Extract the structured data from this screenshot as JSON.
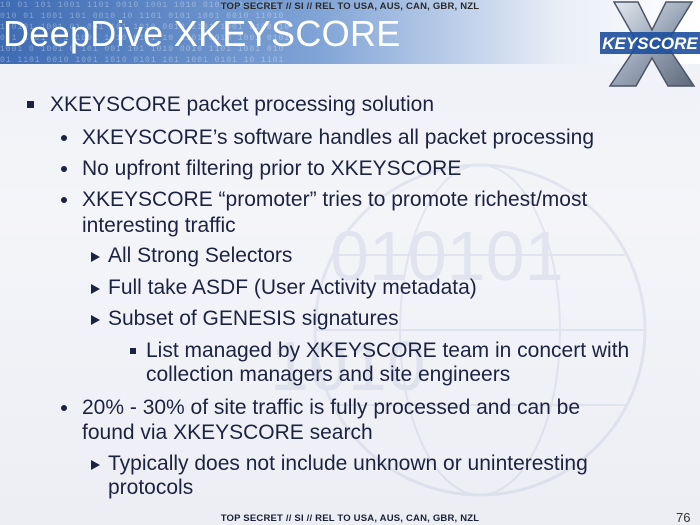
{
  "classification": {
    "top": "TOP SECRET // SI // REL TO USA, AUS, CAN, GBR, NZL",
    "bottom": "TOP SECRET // SI // REL TO USA, AUS, CAN, GBR, NZL"
  },
  "title": "DeepDive XKEYSCORE",
  "logo": {
    "text": "KEYSCORE",
    "icon": "xkeyscore-x-logo"
  },
  "bullets": {
    "l1": "XKEYSCORE packet processing solution",
    "l2a": "XKEYSCORE’s software handles all packet processing",
    "l2b": "No upfront filtering prior to XKEYSCORE",
    "l2c_1": "XKEYSCORE “promoter” tries to promote richest/most",
    "l2c_2": "interesting traffic",
    "l3a": "All Strong Selectors",
    "l3b": "Full take ASDF (User Activity metadata)",
    "l3c": "Subset of GENESIS signatures",
    "l4a_1": "List managed by XKEYSCORE team in concert with",
    "l4a_2": "collection managers and site engineers",
    "l2d_1": "20% - 30% of site traffic is fully processed and can be",
    "l2d_2": "found via XKEYSCORE search",
    "l3d_1": "Typically does not include unknown or uninteresting",
    "l3d_2": "protocols"
  },
  "page_number": "76"
}
